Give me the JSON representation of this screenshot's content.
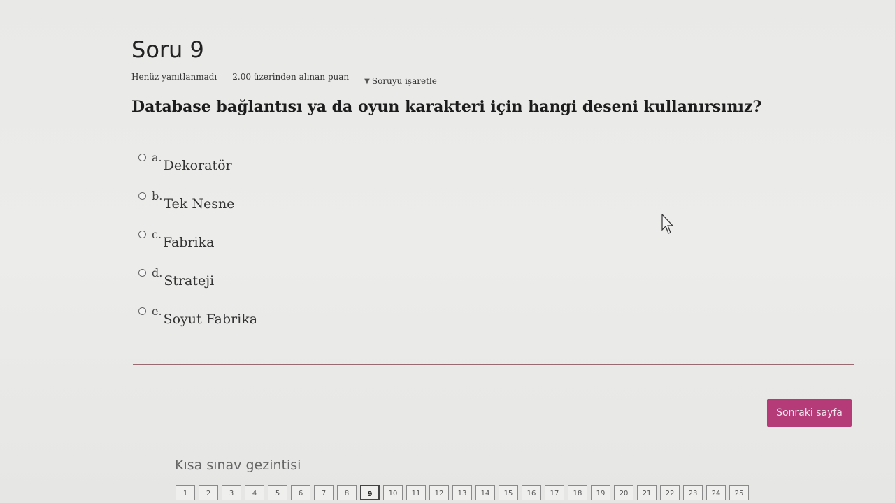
{
  "question": {
    "title": "Soru 9",
    "status": "Henüz yanıtlanmadı",
    "points": "2.00 üzerinden alınan puan",
    "flag_label": "Soruyu işaretle",
    "text": "Database bağlantısı ya da oyun karakteri için hangi deseni kullanırsınız?",
    "answers": [
      {
        "letter": "a.",
        "label": "Dekoratör"
      },
      {
        "letter": "b.",
        "label": "Tek Nesne"
      },
      {
        "letter": "c.",
        "label": "Fabrika"
      },
      {
        "letter": "d.",
        "label": "Strateji"
      },
      {
        "letter": "e.",
        "label": "Soyut Fabrika"
      }
    ]
  },
  "next_button": "Sonraki sayfa",
  "navigation": {
    "title": "Kısa sınav gezintisi",
    "current": "9",
    "pages": [
      "1",
      "2",
      "3",
      "4",
      "5",
      "6",
      "7",
      "8",
      "9",
      "10",
      "11",
      "12",
      "13",
      "14",
      "15",
      "16",
      "17",
      "18",
      "19",
      "20",
      "21",
      "22",
      "23",
      "24",
      "25"
    ]
  },
  "colors": {
    "accent": "#b43a78",
    "divider": "#9a6a72"
  }
}
